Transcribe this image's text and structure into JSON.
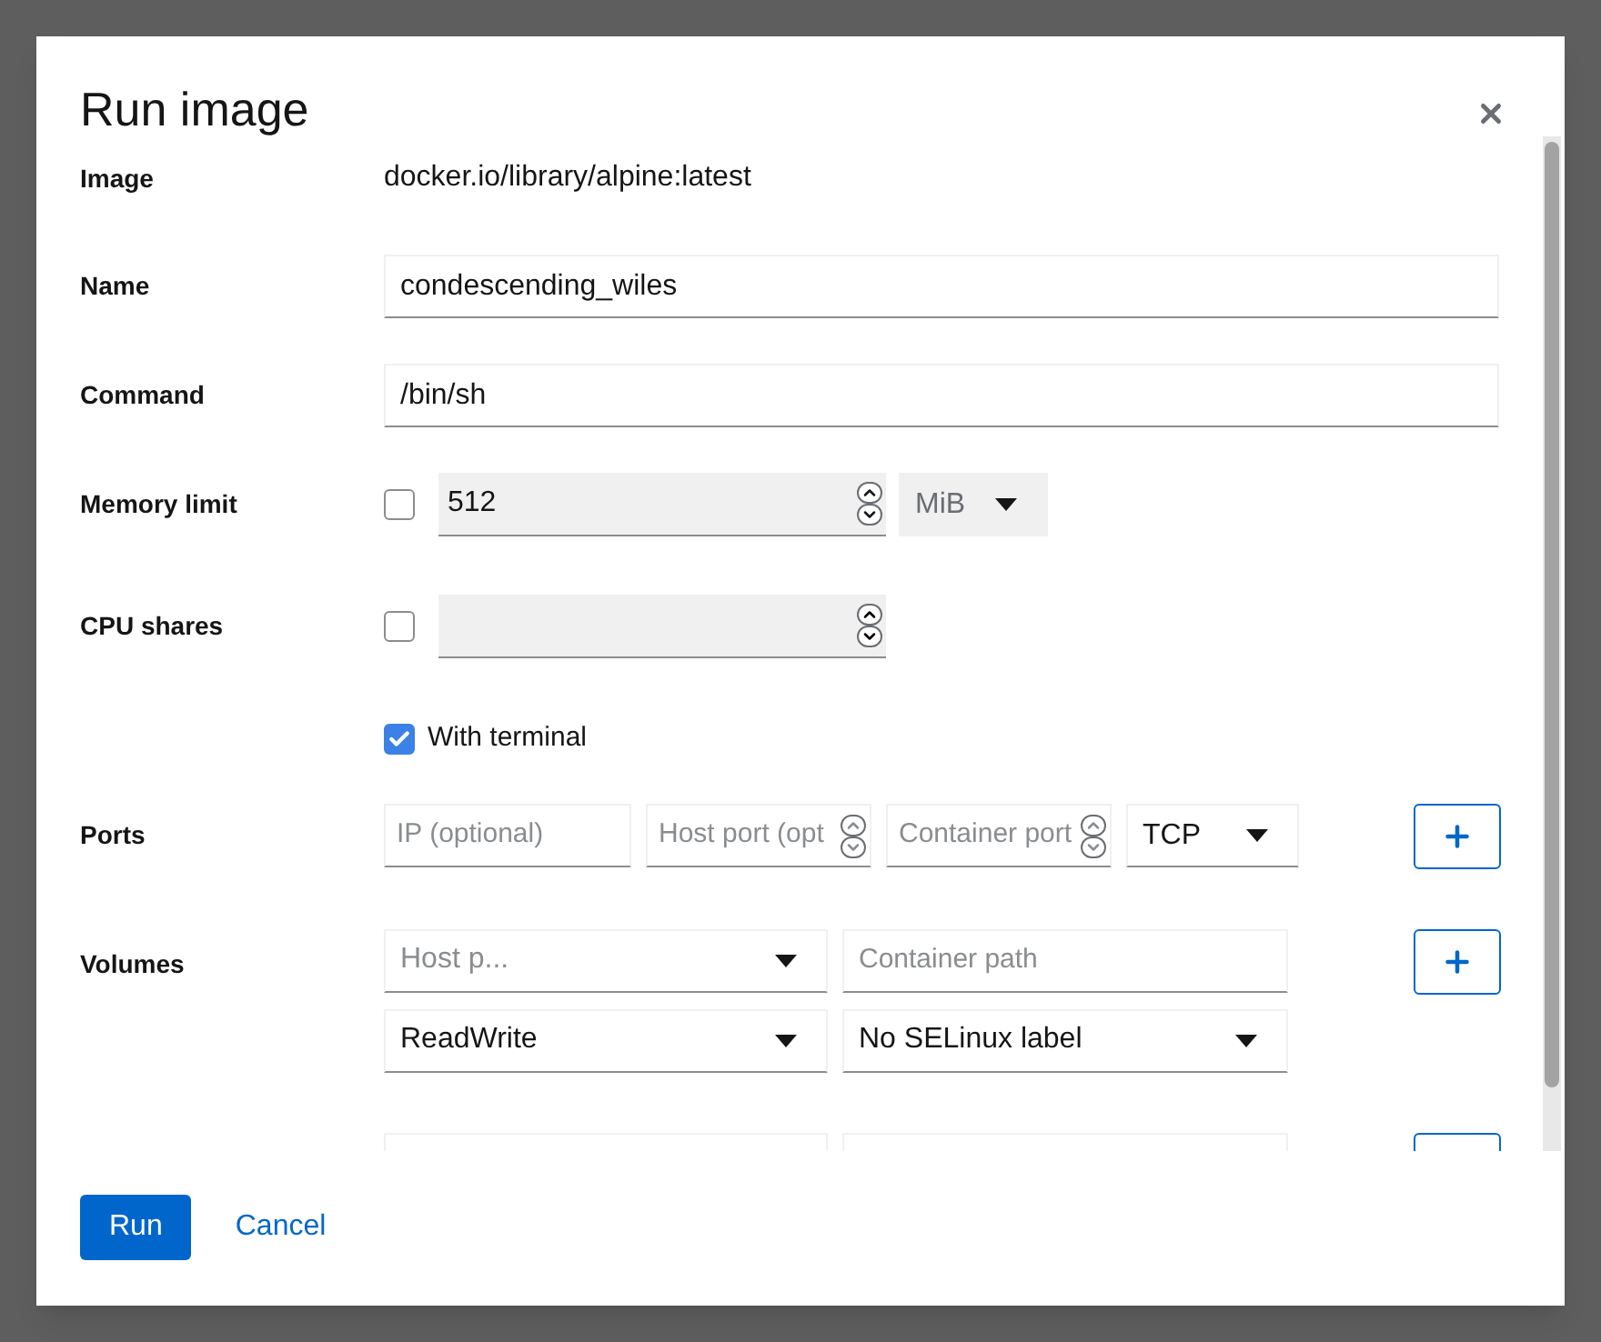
{
  "dialog": {
    "title": "Run image"
  },
  "image": {
    "label": "Image",
    "value": "docker.io/library/alpine:latest"
  },
  "name": {
    "label": "Name",
    "value": "condescending_wiles"
  },
  "command": {
    "label": "Command",
    "value": "/bin/sh"
  },
  "memory_limit": {
    "label": "Memory limit",
    "checked": false,
    "disabled": true,
    "value": "512",
    "unit": "MiB"
  },
  "cpu_shares": {
    "label": "CPU shares",
    "checked": false,
    "disabled": true
  },
  "with_terminal": {
    "label": "With terminal",
    "checked": true
  },
  "ports": {
    "label": "Ports",
    "fields": [
      {
        "placeholder": "IP (optional)",
        "kind": "text"
      },
      {
        "placeholder": "Host port (opt",
        "kind": "number"
      },
      {
        "placeholder": "Container port",
        "kind": "number"
      }
    ],
    "protocol": "TCP"
  },
  "volumes": {
    "label": "Volumes",
    "host_placeholder": "Host p...",
    "container_placeholder": "Container path",
    "mode": "ReadWrite",
    "selinux": "No SELinux label"
  },
  "buttons": [
    {
      "label": "Run",
      "kind": "primary"
    },
    {
      "label": "Cancel",
      "kind": "link"
    }
  ]
}
